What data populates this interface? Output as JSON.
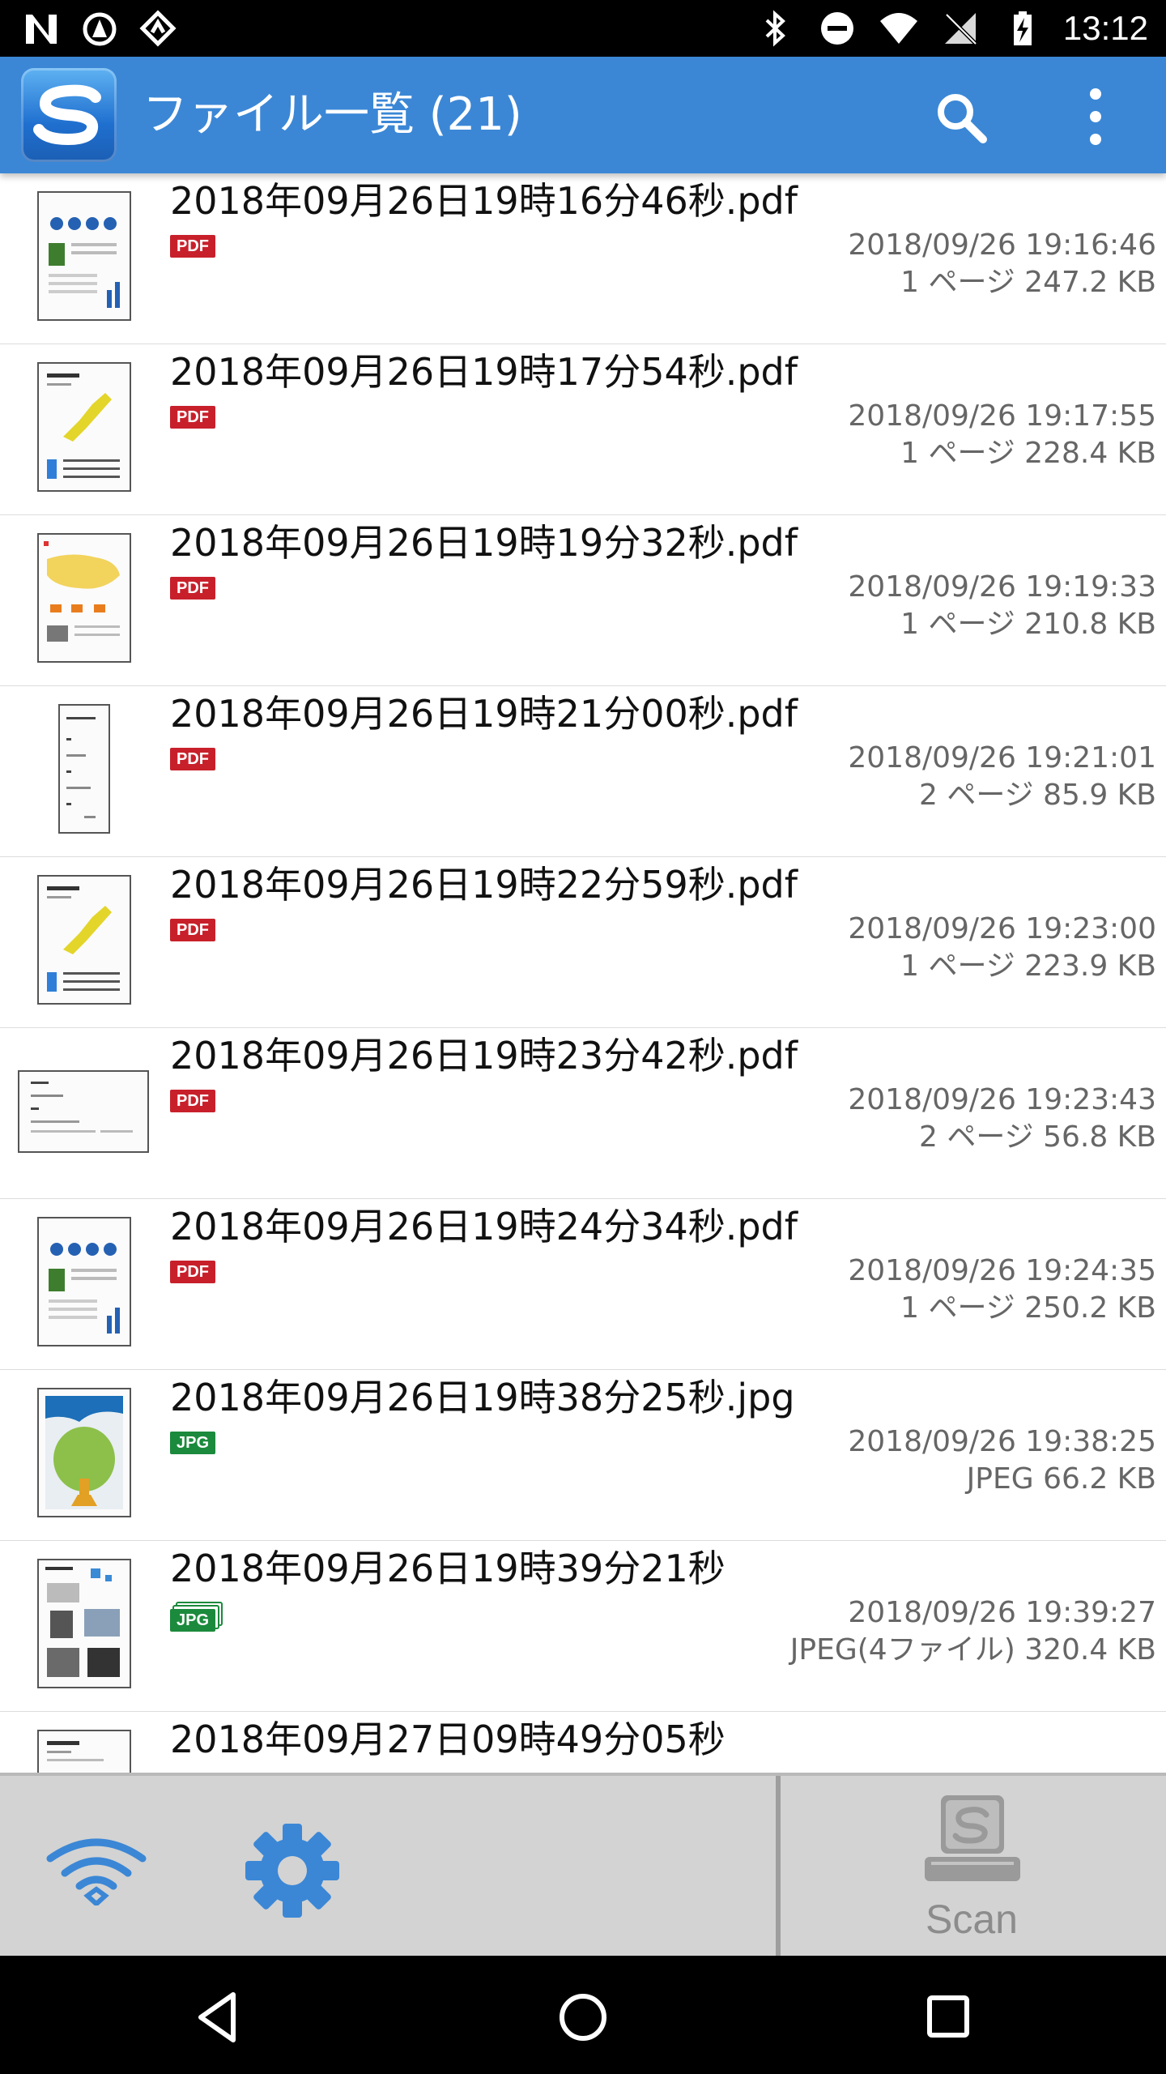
{
  "status_bar": {
    "time": "13:12",
    "icons": [
      "n-notification-icon",
      "signal-icon",
      "signal-icon",
      "bluetooth-icon",
      "do-not-disturb-icon",
      "wifi-icon",
      "no-sim-icon",
      "battery-charging-icon"
    ]
  },
  "app_bar": {
    "title": "ファイル一覧 (21)",
    "logo_icon": "scansnap-logo-icon",
    "search_icon": "search-icon",
    "menu_icon": "overflow-menu-icon",
    "color": "#3b87d6"
  },
  "files": [
    {
      "name": "2018年09月26日19時16分46秒.pdf",
      "type_badge": "PDF",
      "date": "2018/09/26 19:16:46",
      "info": "1 ページ 247.2 KB"
    },
    {
      "name": "2018年09月26日19時17分54秒.pdf",
      "type_badge": "PDF",
      "date": "2018/09/26 19:17:55",
      "info": "1 ページ 228.4 KB"
    },
    {
      "name": "2018年09月26日19時19分32秒.pdf",
      "type_badge": "PDF",
      "date": "2018/09/26 19:19:33",
      "info": "1 ページ 210.8 KB"
    },
    {
      "name": "2018年09月26日19時21分00秒.pdf",
      "type_badge": "PDF",
      "date": "2018/09/26 19:21:01",
      "info": "2 ページ 85.9 KB"
    },
    {
      "name": "2018年09月26日19時22分59秒.pdf",
      "type_badge": "PDF",
      "date": "2018/09/26 19:23:00",
      "info": "1 ページ 223.9 KB"
    },
    {
      "name": "2018年09月26日19時23分42秒.pdf",
      "type_badge": "PDF",
      "date": "2018/09/26 19:23:43",
      "info": "2 ページ 56.8 KB"
    },
    {
      "name": "2018年09月26日19時24分34秒.pdf",
      "type_badge": "PDF",
      "date": "2018/09/26 19:24:35",
      "info": "1 ページ 250.2 KB"
    },
    {
      "name": "2018年09月26日19時38分25秒.jpg",
      "type_badge": "JPG",
      "date": "2018/09/26 19:38:25",
      "info": "JPEG 66.2 KB"
    },
    {
      "name": "2018年09月26日19時39分21秒",
      "type_badge": "JPG",
      "date": "2018/09/26 19:39:27",
      "info": "JPEG(4ファイル) 320.4 KB"
    },
    {
      "name": "2018年09月27日09時49分05秒",
      "type_badge": "",
      "date": "",
      "info": ""
    }
  ],
  "toolbar": {
    "wifi_icon": "wifi-connection-icon",
    "settings_icon": "gear-icon",
    "scan_icon": "scanner-icon",
    "scan_label": "Scan"
  },
  "nav_bar": {
    "back_icon": "back-icon",
    "home_icon": "home-icon",
    "recents_icon": "recents-icon"
  },
  "colors": {
    "pdf_badge": "#c8202b",
    "jpg_badge": "#1b8a3c",
    "accent": "#3b87d6"
  }
}
